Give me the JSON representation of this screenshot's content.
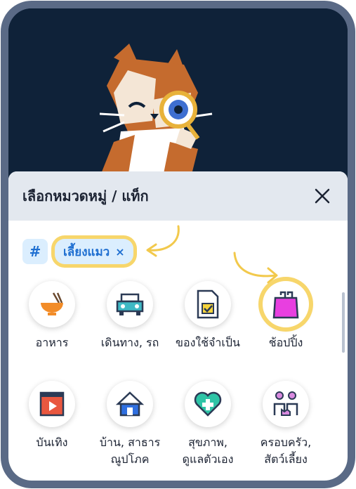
{
  "sheet": {
    "title": "เลือกหมวดหมู่ / แท็ก"
  },
  "tags": {
    "hash_symbol": "#",
    "selected_tag": "เลี้ยงแมว",
    "remove_symbol": "×"
  },
  "categories": [
    {
      "label_line1": "อาหาร",
      "label_line2": "",
      "icon": "food-bowl-icon"
    },
    {
      "label_line1": "เดินทาง, รถ",
      "label_line2": "",
      "icon": "car-icon"
    },
    {
      "label_line1": "ของใช้จำเป็น",
      "label_line2": "",
      "icon": "document-check-icon"
    },
    {
      "label_line1": "ช้อปปิ้ง",
      "label_line2": "",
      "icon": "shopping-bag-icon",
      "highlighted": true
    },
    {
      "label_line1": "บันเทิง",
      "label_line2": "",
      "icon": "video-play-icon"
    },
    {
      "label_line1": "บ้าน, สาธาร",
      "label_line2": "ณูปโภค",
      "icon": "house-icon"
    },
    {
      "label_line1": "สุขภาพ,",
      "label_line2": "ดูแลตัวเอง",
      "icon": "heart-health-icon"
    },
    {
      "label_line1": "ครอบครัว,",
      "label_line2": "สัตว์เลี้ยง",
      "icon": "family-pet-icon"
    }
  ],
  "colors": {
    "frame": "#5a6a86",
    "hero_bg": "#0f2239",
    "highlight": "#f7d66b",
    "chip_bg": "#dbeefe",
    "chip_text": "#1f6fd1"
  }
}
